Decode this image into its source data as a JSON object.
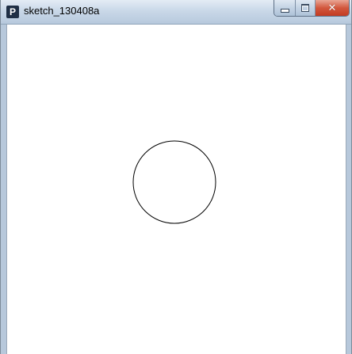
{
  "window": {
    "title": "sketch_130408a",
    "app_icon_letter": "P",
    "controls": {
      "minimize_icon": "minimize-icon",
      "maximize_icon": "maximize-icon",
      "close_icon": "close-icon"
    }
  },
  "sketch": {
    "shape": "circle",
    "background_color": "#ffffff",
    "stroke_color": "#000000",
    "fill": "none"
  },
  "colors": {
    "close_button": "#c8452b",
    "titlebar": "#c9d8e8"
  }
}
